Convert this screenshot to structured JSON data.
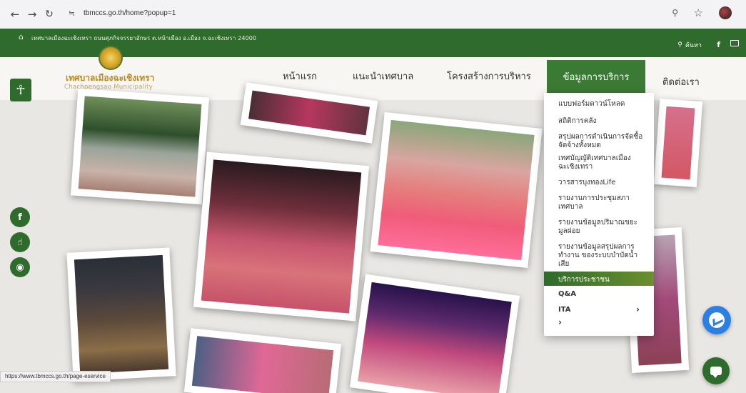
{
  "browser": {
    "back": "←",
    "forward": "→",
    "reload": "↻",
    "tune": "≒",
    "url": "tbmccs.go.th/home?popup=1",
    "zoom": "⚲",
    "star": "☆"
  },
  "topbar": {
    "home_icon": "⌂",
    "address": "เทศบาลเมืองฉะเชิงเทรา ถนนศุภกิจจรรยาอักษร ต.หน้าเมือง อ.เมือง จ.ฉะเชิงเทรา 24000"
  },
  "header": {
    "search_label": "ค้นหา",
    "search_icon": "⚲",
    "facebook": "f"
  },
  "logo": {
    "title": "เทศบาลเมืองฉะเชิงเทรา",
    "subtitle": "Chachoengsao Municipality"
  },
  "nav": {
    "home": "หน้าแรก",
    "intro": "แนะนำเทศบาล",
    "structure": "โครงสร้างการบริหาร",
    "services": "ข้อมูลการบริการ",
    "contact": "ติดต่อเรา"
  },
  "dropdown": {
    "items": [
      "แบบฟอร์มดาวน์โหลด",
      "สถิติการคลัง",
      "สรุปผลการดำเนินการจัดซื้อจัดจ้างทั้งหมด",
      "เทศบัญญัติเทศบาลเมืองฉะเชิงเทรา",
      "วารสารบุงทองLife",
      "รายงานการประชุมสภาเทศบาล",
      "รายงานข้อมูลปริมาณขยะมูลฝอย",
      "รายงานข้อมูลสรุปผลการทำงาน ของระบบบำบัดน้ำเสีย"
    ],
    "highlight": "บริการประชาชน",
    "qa": "Q&A",
    "ita": "ITA",
    "arrow": "›"
  },
  "side": {
    "accessibility": "☥",
    "facebook": "f",
    "hand": "☝",
    "globe": "◉"
  },
  "status_url": "https://www.tbmccs.go.th/page-eservice"
}
